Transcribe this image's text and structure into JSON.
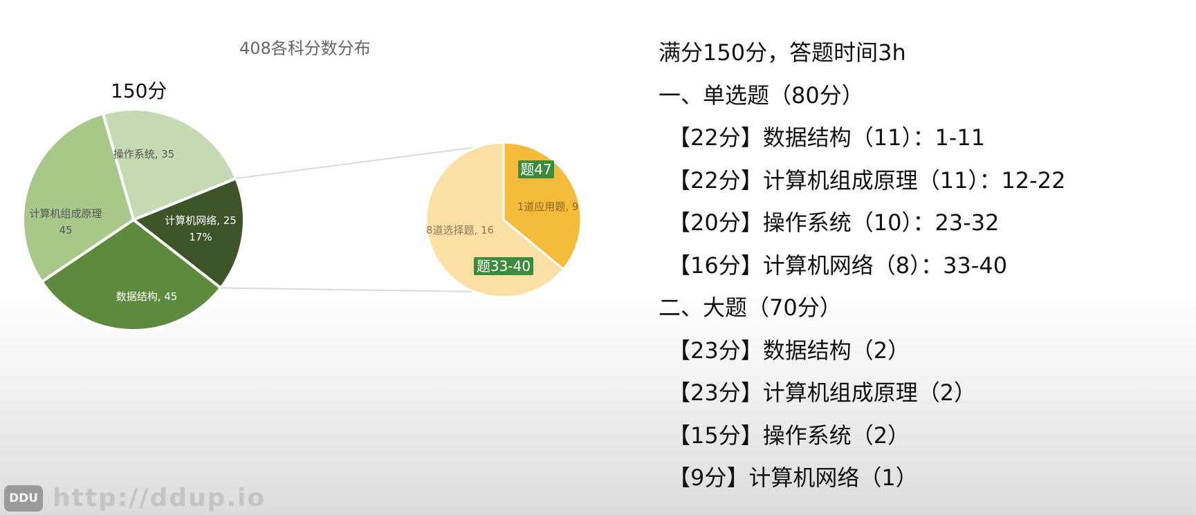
{
  "chart_data": {
    "type": "pie",
    "title": "408各科分数分布",
    "total_label": "150分",
    "main_pie": {
      "slices": [
        {
          "name": "操作系统",
          "value": 35,
          "label": "操作系统, 35",
          "color": "#c5d9b3"
        },
        {
          "name": "计算机网络",
          "value": 25,
          "label": "计算机网络, 25",
          "percent_label": "17%",
          "color": "#3c5428"
        },
        {
          "name": "数据结构",
          "value": 45,
          "label": "数据结构, 45",
          "color": "#5e8a3d"
        },
        {
          "name": "计算机组成原理",
          "value": 45,
          "label": "计算机组成原理",
          "value_label": "45",
          "color": "#a8c88a"
        }
      ]
    },
    "sub_pie": {
      "parent": "计算机网络",
      "slices": [
        {
          "name": "1道应用题",
          "value": 9,
          "label": "1道应用题, 9",
          "color": "#f5bb3a",
          "annotation": "题47"
        },
        {
          "name": "8道选择题",
          "value": 16,
          "label": "8道选择题, 16",
          "color": "#fbe0a6",
          "annotation": "题33-40"
        }
      ],
      "annotation_color": "#3c8a3c"
    }
  },
  "notes": {
    "lines": [
      {
        "text": "满分150分，答题时间3h",
        "kind": "heading"
      },
      {
        "text": "一、单选题（80分）",
        "kind": "heading"
      },
      {
        "text": "【22分】数据结构（11）：1-11",
        "kind": "item"
      },
      {
        "text": "【22分】计算机组成原理（11）：12-22",
        "kind": "item"
      },
      {
        "text": "【20分】操作系统（10）：23-32",
        "kind": "item"
      },
      {
        "text": "【16分】计算机网络（8）：33-40",
        "kind": "item"
      },
      {
        "text": "二、大题（70分）",
        "kind": "heading"
      },
      {
        "text": "【23分】数据结构（2）",
        "kind": "item"
      },
      {
        "text": "【23分】计算机组成原理（2）",
        "kind": "item"
      },
      {
        "text": "【15分】操作系统（2）",
        "kind": "item"
      },
      {
        "text": "【9分】计算机网络（1）",
        "kind": "item"
      }
    ]
  },
  "watermark": {
    "badge": "DDU",
    "url": "http://ddup.io"
  }
}
